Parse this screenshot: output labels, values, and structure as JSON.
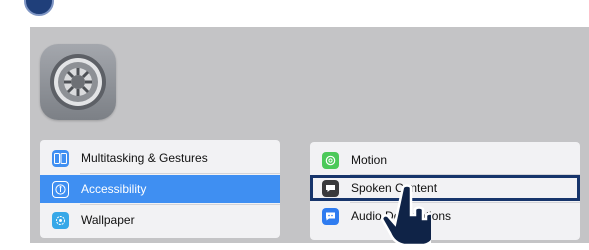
{
  "settings": {
    "left_list": [
      {
        "label": "Multitasking & Gestures",
        "icon": "multitasking-icon",
        "color": "#3f8ff2"
      },
      {
        "label": "Accessibility",
        "icon": "accessibility-icon",
        "color": "#3f8ff2",
        "selected": true
      },
      {
        "label": "Wallpaper",
        "icon": "wallpaper-icon",
        "color": "#37a8e8"
      }
    ],
    "right_list": [
      {
        "label": "Motion",
        "icon": "motion-icon",
        "color": "#4cc95a"
      },
      {
        "label": "Spoken Content",
        "icon": "spoken-content-icon",
        "color": "#3a3a3c",
        "highlighted": true
      },
      {
        "label": "Audio Descriptions",
        "icon": "audio-descriptions-icon",
        "color": "#2f7cf0"
      }
    ]
  },
  "colors": {
    "panel_bg": "#c4c4c6",
    "selection": "#3f8ff2",
    "highlight_border": "#17356b"
  }
}
